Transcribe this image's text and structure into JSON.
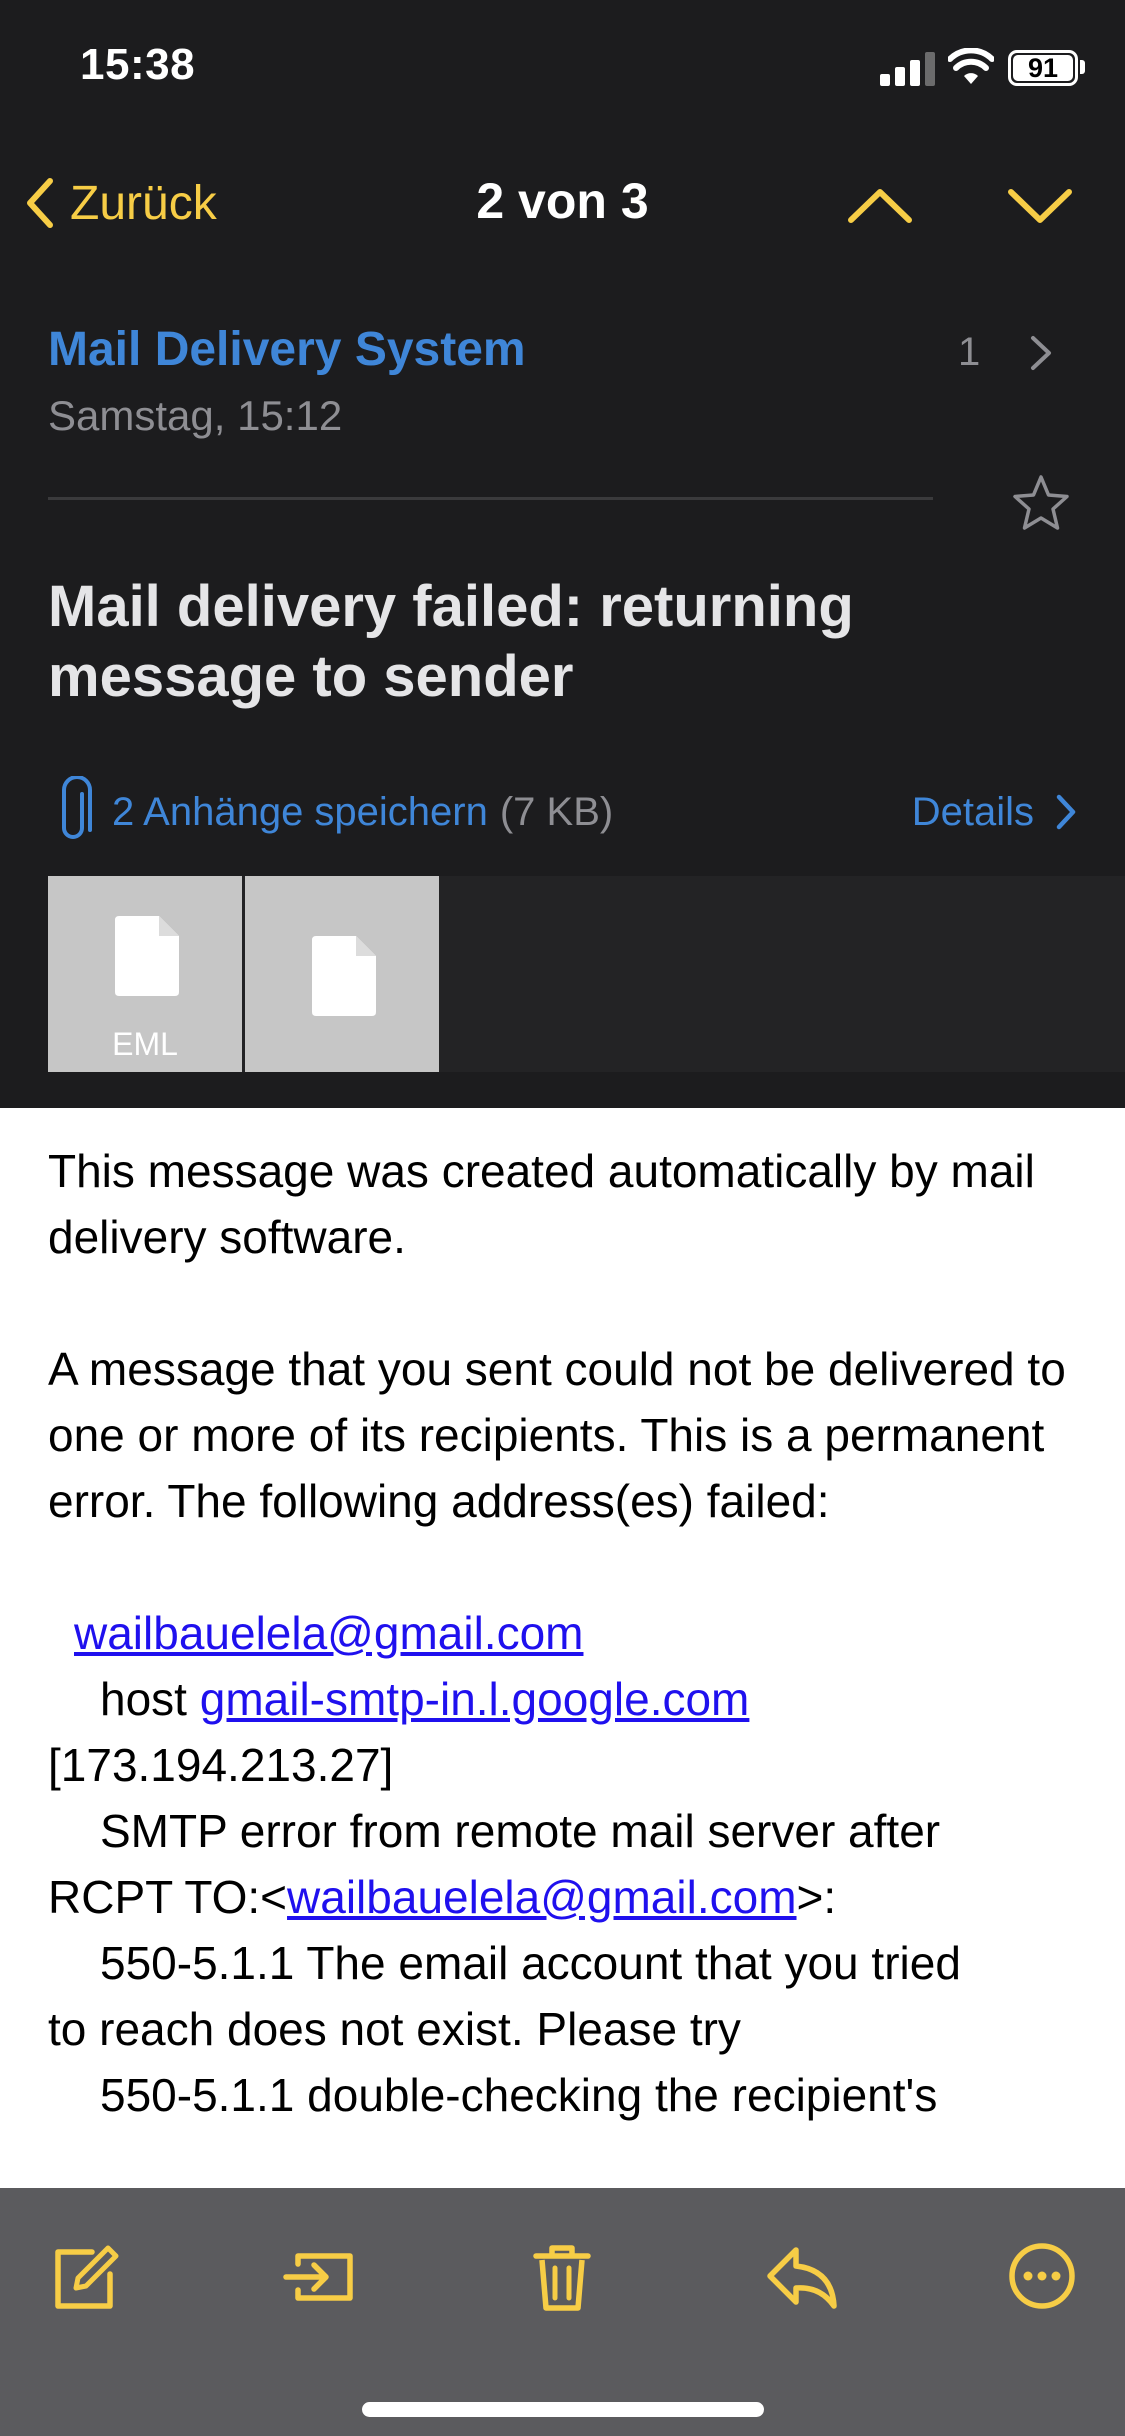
{
  "status_bar": {
    "time": "15:38",
    "battery": "91"
  },
  "nav": {
    "back_label": "Zurück",
    "counter": "2 von 3"
  },
  "header": {
    "sender": "Mail Delivery System",
    "date": "Samstag, 15:12",
    "thread_count": "1",
    "subject": "Mail delivery failed: returning message to sender",
    "attachments_link": "2 Anhänge speichern",
    "attachments_size": "(7 KB)",
    "details_label": "Details",
    "attachments": [
      {
        "label": "EML",
        "icon": "document-icon"
      },
      {
        "label": "",
        "icon": "document-icon"
      }
    ]
  },
  "body": {
    "p1": "This message was created automatically by mail delivery software.",
    "p2": "A message that you sent could not be delivered to one or more of its recipients. This is a permanent error. The following address(es) failed:",
    "failed_address": "wailbauelela@gmail.com",
    "host_prefix": "host ",
    "host": "gmail-smtp-in.l.google.com",
    "ip": "[173.194.213.27]",
    "smtp_error": "SMTP error from remote mail server after",
    "rcpt_prefix": "RCPT TO:<",
    "rcpt_address": "wailbauelela@gmail.com",
    "rcpt_suffix": ">:",
    "line_550a": "550-5.1.1 The email account that you tried",
    "line_reach": "to reach does not exist. Please try",
    "line_550b": "550-5.1.1 double-checking the recipient's"
  },
  "toolbar": {
    "icons": [
      "compose-icon",
      "move-to-folder-icon",
      "trash-icon",
      "reply-icon",
      "more-icon"
    ]
  },
  "colors": {
    "accent": "#f7cd46",
    "link": "#3f86d8",
    "background": "#1c1c1e",
    "toolbar": "#5b5b5e"
  }
}
